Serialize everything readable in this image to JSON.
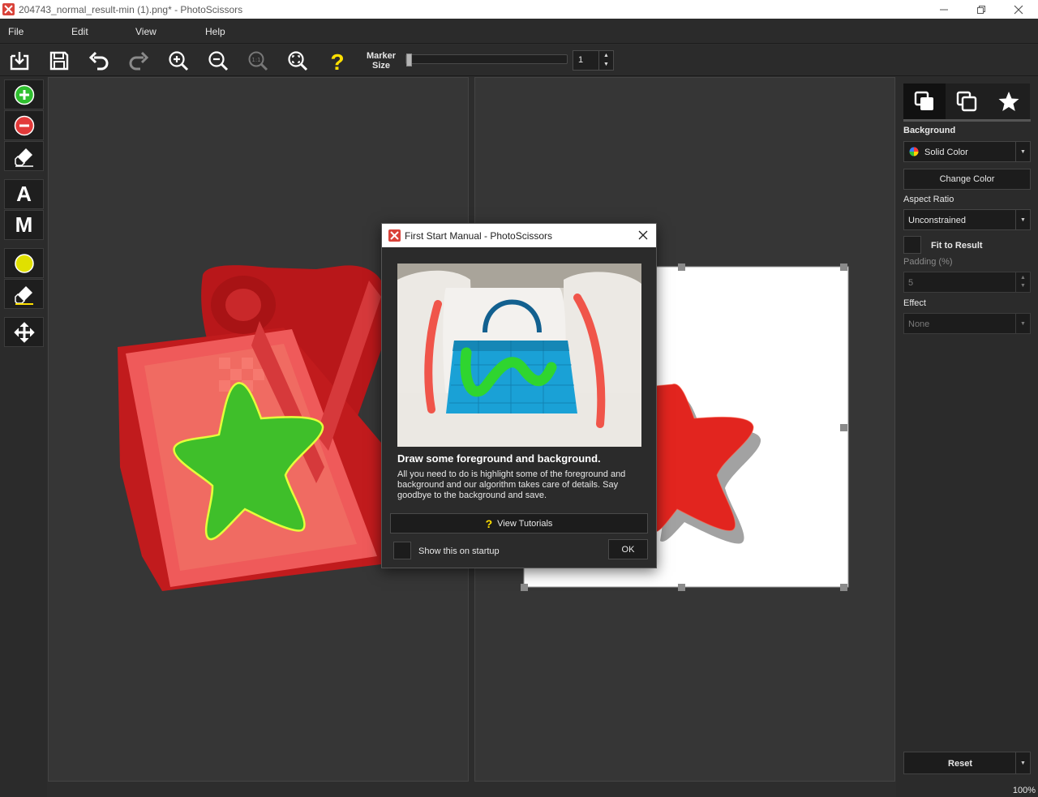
{
  "window": {
    "title": "204743_normal_result-min (1).png* - PhotoScissors"
  },
  "menu": [
    "File",
    "Edit",
    "View",
    "Help"
  ],
  "toolbar": {
    "marker_label_1": "Marker",
    "marker_label_2": "Size",
    "marker_size_value": "1"
  },
  "right_panel": {
    "background_label": "Background",
    "background_value": "Solid Color",
    "change_color": "Change Color",
    "aspect_ratio_label": "Aspect Ratio",
    "aspect_ratio_value": "Unconstrained",
    "fit_to_result": "Fit to Result",
    "padding_label": "Padding (%)",
    "padding_value": "5",
    "effect_label": "Effect",
    "effect_value": "None",
    "reset": "Reset"
  },
  "status": {
    "zoom": "100%"
  },
  "dialog": {
    "title": "First Start Manual - PhotoScissors",
    "heading": "Draw some foreground and background.",
    "body": "All you need to do is highlight some of the foreground and background and our algorithm takes care of details. Say goodbye to the background and save.",
    "view_tutorials": "View Tutorials",
    "show_on_startup": "Show this on startup",
    "ok": "OK"
  },
  "colors": {
    "accent_green": "#2fbf2f",
    "accent_red": "#e23a3a",
    "accent_yellow": "#ffe000",
    "panel_bg": "#2b2b2b",
    "canvas_bg": "#363636"
  }
}
